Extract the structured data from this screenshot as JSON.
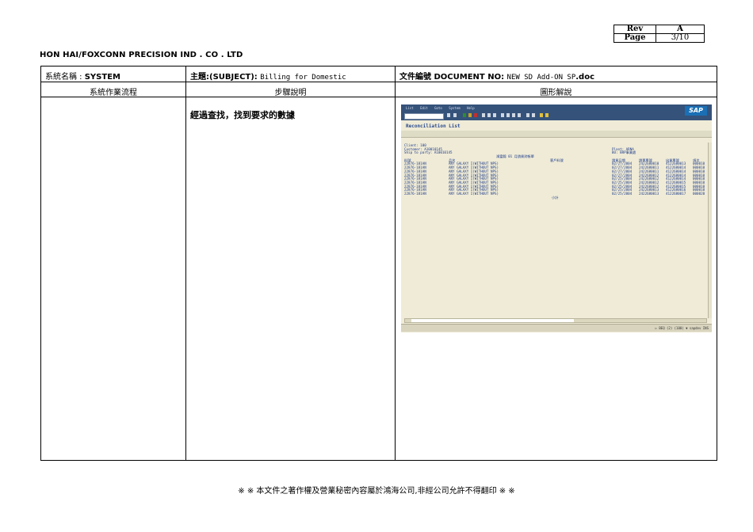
{
  "header": {
    "rev_label": "Rev",
    "rev_value": "A",
    "page_label": "Page",
    "page_value": "3/10",
    "company": "HON HAI/FOXCONN PRECISION IND . CO . LTD"
  },
  "info_row": {
    "system_label": "系統名稱 : ",
    "system_value": "SYSTEM",
    "subject_label": "主題:(SUBJECT): ",
    "subject_value": "Billing for Domestic",
    "docno_label": "文件編號 DOCUMENT NO: ",
    "docno_value": "NEW SD Add-ON SP",
    "docno_ext": ".doc"
  },
  "columns": {
    "flow": "系統作業流程",
    "steps": "步驟說明",
    "graphic": "圖形解說"
  },
  "step_text": "經過查找，找到要求的數據",
  "sap": {
    "menu": [
      "List",
      "Edit",
      "Goto",
      "System",
      "Help"
    ],
    "logo": "SAP",
    "title": "Reconciliation List",
    "client": "Client: 100",
    "customer": "Customer: A10010145",
    "ship_to": "Ship to party: A10010145",
    "plant": "Plant: ARNA",
    "bu": "BU: BRP事業處",
    "report_heading": "鴻富錦 01 月銷貨對帳單",
    "col_material": "料號",
    "col_desc": "品名",
    "col_cust_material": "客戶料號",
    "col_bill_date": "銷貨日期",
    "col_bill_no": "銷單單號",
    "col_delivery_no": "出貨單號",
    "col_item": "項次",
    "rows": [
      {
        "material": "22876-181AN",
        "desc": "ANY GALAXY I(WITHOUT NPS)",
        "date": "02/27/2004",
        "bill": "2422680010",
        "delivery": "4122680013",
        "item": "000010"
      },
      {
        "material": "22876-181AN",
        "desc": "ANY GALAXY I(WITHOUT NPS)",
        "date": "02/27/2004",
        "bill": "2422680011",
        "delivery": "4122680014",
        "item": "000010"
      },
      {
        "material": "22876-181AN",
        "desc": "ANY GALAXY I(WITHOUT NPS)",
        "date": "02/27/2004",
        "bill": "2422680011",
        "delivery": "4122680014",
        "item": "000010"
      },
      {
        "material": "22876-181AN",
        "desc": "ANY GALAXY I(WITHOUT NPS)",
        "date": "02/27/2004",
        "bill": "2422680012",
        "delivery": "4122680014",
        "item": "000010"
      },
      {
        "material": "22876-181AN",
        "desc": "ANY GALAXY I(WITHOUT NPS)",
        "date": "02/25/2004",
        "bill": "2422680012",
        "delivery": "4122680014",
        "item": "000010"
      },
      {
        "material": "22876-181AN",
        "desc": "ANY GALAXY I(WITHOUT NPS)",
        "date": "02/25/2004",
        "bill": "2422680012",
        "delivery": "4122680015",
        "item": "000010"
      },
      {
        "material": "22876-181AN",
        "desc": "ANY GALAXY I(WITHOUT NPS)",
        "date": "02/25/2004",
        "bill": "2422680012",
        "delivery": "4122680015",
        "item": "000010"
      },
      {
        "material": "22876-181AN",
        "desc": "ANY GALAXY I(WITHOUT NPS)",
        "date": "02/25/2004",
        "bill": "2422680013",
        "delivery": "4122680016",
        "item": "000010"
      },
      {
        "material": "22876-181AN",
        "desc": "ANY GALAXY I(WITHOUT NPS)",
        "date": "02/25/2004",
        "bill": "2422680013",
        "delivery": "4122680017",
        "item": "000020"
      }
    ],
    "subtotal": "小計",
    "status": "▷ BEQ (2) (100) ▼ sapdev INS"
  },
  "footer": "※ ※ 本文件之著作權及營業秘密內容屬於鴻海公司,非經公司允許不得翻印 ※ ※"
}
